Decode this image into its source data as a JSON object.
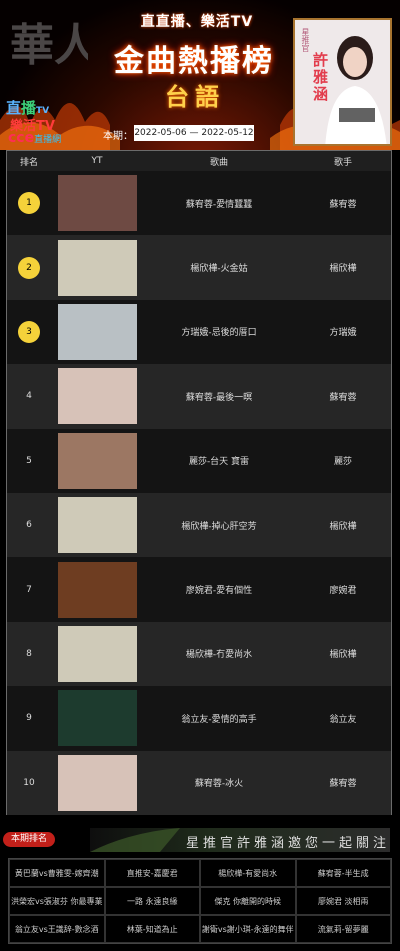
{
  "header": {
    "logo_glyph": "華人",
    "brand_top": "直直播、樂活TV",
    "title": "金曲熱播榜",
    "subtitle": "台語",
    "period_label": "本期：",
    "period_range": "2022-05-06 — 2022-05-12",
    "logos": {
      "line1": "直",
      "line1_b": "播",
      "line1_small": "TV",
      "line2": "樂活TV",
      "line3": "cce",
      "line3_small": "直播網"
    },
    "promo": {
      "tag": "星推官",
      "name": "許雅涵"
    }
  },
  "table": {
    "headers": [
      "排名",
      "YT",
      "歌曲",
      "歌手"
    ],
    "rows": [
      {
        "rank": "1",
        "song": "蘇宥蓉-愛情蠶蠶",
        "artist": "蘇宥蓉",
        "thumb_color": "#6e4a43"
      },
      {
        "rank": "2",
        "song": "楊欣樺-火金姑",
        "artist": "楊欣樺",
        "thumb_color": "#cfcab8"
      },
      {
        "rank": "3",
        "song": "方瑞娥-忌後的厝口",
        "artist": "方瑞娥",
        "thumb_color": "#b9c0c4"
      },
      {
        "rank": "4",
        "song": "蘇宥蓉-最後一暝",
        "artist": "蘇宥蓉",
        "thumb_color": "#d7c2b8"
      },
      {
        "rank": "5",
        "song": "麗莎-台天   寶雷",
        "artist": "麗莎",
        "thumb_color": "#9c7763"
      },
      {
        "rank": "6",
        "song": "楊欣樺-掉心肝空芳",
        "artist": "楊欣樺",
        "thumb_color": "#cfcab8"
      },
      {
        "rank": "7",
        "song": "廖婉君-愛有個性",
        "artist": "廖婉君",
        "thumb_color": "#6e3d21"
      },
      {
        "rank": "8",
        "song": "楊欣樺-冇愛尚水",
        "artist": "楊欣樺",
        "thumb_color": "#cfcab8"
      },
      {
        "rank": "9",
        "song": "翁立友-愛情的高手",
        "artist": "翁立友",
        "thumb_color": "#1d3b2e"
      },
      {
        "rank": "10",
        "song": "蘇宥蓉-冰火",
        "artist": "蘇宥蓉",
        "thumb_color": "#d7c2b8"
      }
    ],
    "badge_color": "#f5d23a"
  },
  "footer": {
    "title": "本期排名",
    "banner": "星推官許雅涵邀您一起關注",
    "items": [
      "黃巴蘭vs曹雅雯-嫁齊潮",
      "直推安-嘉慶君",
      "楊欣樺-有愛尚水",
      "蘇宥蓉-半生成",
      "洪榮宏vs張淑芬 你最專業",
      "一路 永遠良緣",
      "傑克 你離開的時候",
      "廖婉君 淡相兩",
      "翁立友vs王識辞-數念酒",
      "林葉-知道為止",
      "謝衛vs謝小琪-永遠的舞伴",
      "流氣莉-留夢麗"
    ]
  }
}
